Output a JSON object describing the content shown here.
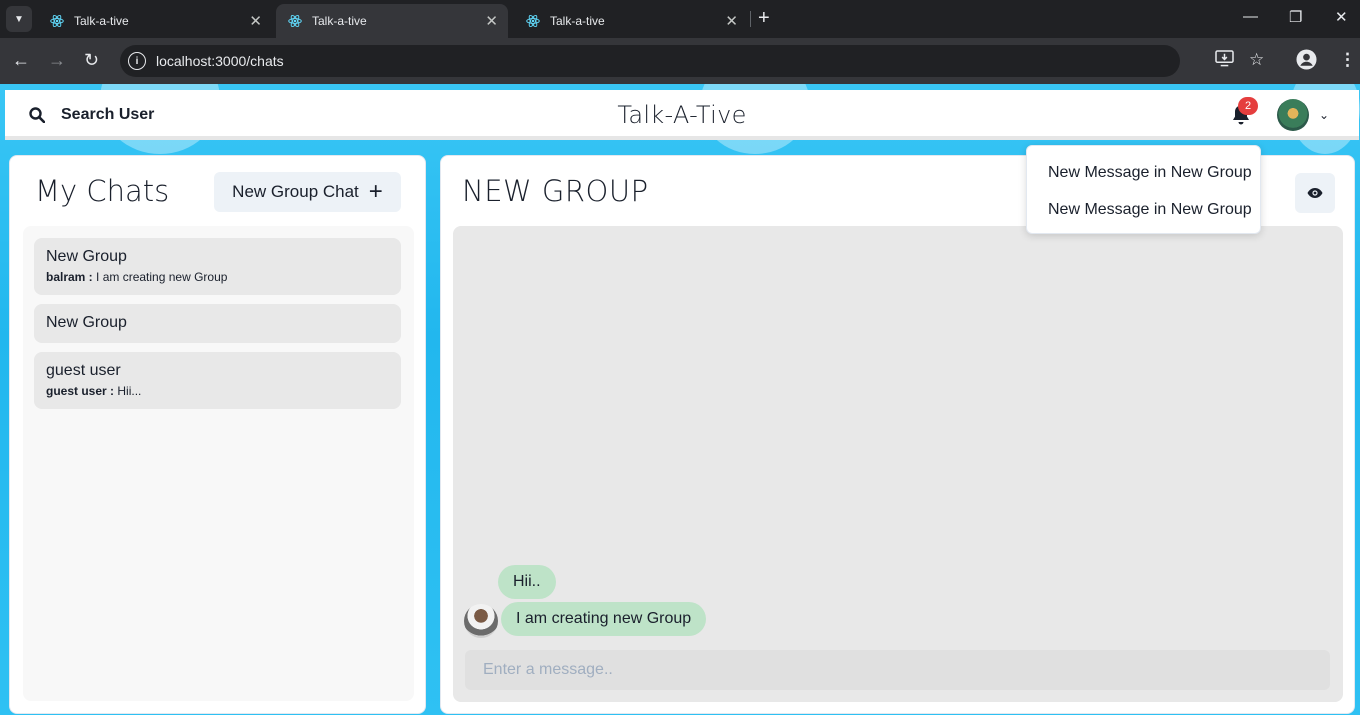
{
  "browser": {
    "tabs": [
      {
        "title": "Talk-a-tive",
        "active": false
      },
      {
        "title": "Talk-a-tive",
        "active": true
      },
      {
        "title": "Talk-a-tive",
        "active": false
      }
    ],
    "url": "localhost:3000/chats"
  },
  "header": {
    "search_label": "Search User",
    "app_title": "Talk-A-Tive",
    "notification_count": "2"
  },
  "notifications": [
    "New Message in New Group",
    "New Message in New Group"
  ],
  "my_chats": {
    "title": "My Chats",
    "new_group_label": "New Group Chat",
    "chats": [
      {
        "name": "New Group",
        "sender": "balram :",
        "latest": "I am creating new Group"
      },
      {
        "name": "New Group",
        "sender": "",
        "latest": ""
      },
      {
        "name": "guest user",
        "sender": "guest user :",
        "latest": "Hii..."
      }
    ]
  },
  "chat": {
    "title": "NEW GROUP",
    "messages": [
      {
        "text": "Hii.."
      },
      {
        "text": "I am creating new Group"
      }
    ],
    "input_placeholder": "Enter a message.."
  },
  "colors": {
    "background": "#2fc1f3",
    "message_bubble": "#bee3c8",
    "badge": "#e53e3e"
  }
}
